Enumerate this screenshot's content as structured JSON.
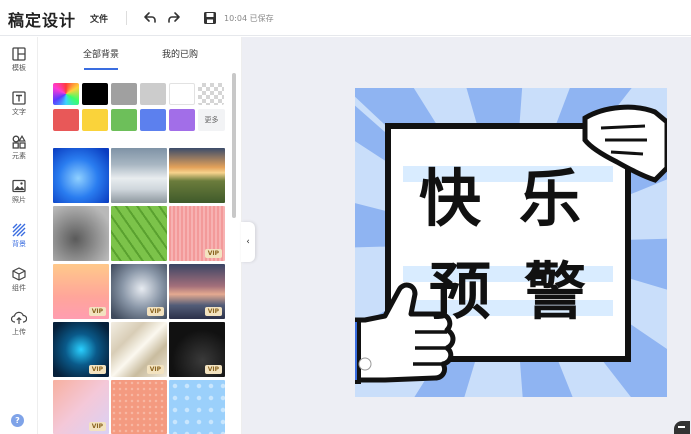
{
  "app": {
    "logo": "稿定设计",
    "menu_file": "文件",
    "save_status": "10:04 已保存"
  },
  "rail": {
    "items": [
      {
        "label": "模板",
        "icon": "template-icon"
      },
      {
        "label": "文字",
        "icon": "text-icon"
      },
      {
        "label": "元素",
        "icon": "elements-icon"
      },
      {
        "label": "照片",
        "icon": "photo-icon"
      },
      {
        "label": "背景",
        "icon": "background-icon",
        "active": true
      },
      {
        "label": "组件",
        "icon": "component-icon"
      },
      {
        "label": "上传",
        "icon": "upload-icon"
      }
    ],
    "help": "?"
  },
  "panel": {
    "tabs": [
      {
        "label": "全部背景",
        "active": true
      },
      {
        "label": "我的已购",
        "active": false
      }
    ],
    "colors": [
      "gradient",
      "#000000",
      "#a0a0a0",
      "#cccccc",
      "#ffffff",
      "transparent",
      "#e85858",
      "#fad33a",
      "#6dbf5a",
      "#5c80ee",
      "#a26ee8"
    ],
    "more_label": "更多",
    "vip_label": "VIP",
    "thumbnails": [
      {
        "name": "blue-blur",
        "vip": false
      },
      {
        "name": "mountain-clouds",
        "vip": false
      },
      {
        "name": "sunset-field",
        "vip": false
      },
      {
        "name": "grey-texture",
        "vip": false
      },
      {
        "name": "green-leaf",
        "vip": false
      },
      {
        "name": "pink-pattern",
        "vip": true
      },
      {
        "name": "peach-gradient",
        "vip": true
      },
      {
        "name": "storm-clouds",
        "vip": true
      },
      {
        "name": "lake-sunset",
        "vip": true
      },
      {
        "name": "blue-network",
        "vip": true
      },
      {
        "name": "silk-cream",
        "vip": true
      },
      {
        "name": "dark-sparkle",
        "vip": true
      },
      {
        "name": "pastel-gradient",
        "vip": true
      },
      {
        "name": "coral-pattern",
        "vip": true
      },
      {
        "name": "blue-geometric",
        "vip": true
      }
    ]
  },
  "poster": {
    "line1_char1": "快",
    "line1_char2": "乐",
    "line2_char1": "预",
    "line2_char2": "警"
  }
}
